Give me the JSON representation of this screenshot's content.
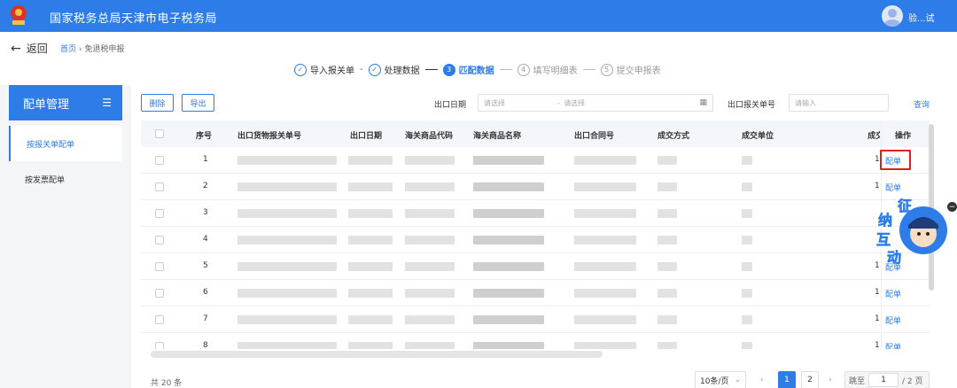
{
  "header": {
    "title": "国家税务总局天津市电子税务局",
    "user": "验...试"
  },
  "nav": {
    "back": "返回",
    "breadcrumb": [
      "首页",
      "免退税申报"
    ]
  },
  "steps": [
    {
      "label": "导入报关单",
      "status": "done",
      "mark": "✓"
    },
    {
      "label": "处理数据",
      "status": "done",
      "mark": "✓"
    },
    {
      "label": "匹配数据",
      "status": "active",
      "mark": "3"
    },
    {
      "label": "填写明细表",
      "status": "todo",
      "mark": "4"
    },
    {
      "label": "提交申报表",
      "status": "todo",
      "mark": "5"
    }
  ],
  "sidebar": {
    "title": "配单管理",
    "items": [
      {
        "label": "按报关单配单",
        "active": true
      },
      {
        "label": "按发票配单",
        "active": false
      }
    ]
  },
  "toolbar": {
    "delete_label": "删除",
    "export_label": "导出",
    "date_label": "出口日期",
    "date_start_placeholder": "请选择",
    "date_sep": "-",
    "date_end_placeholder": "请选择",
    "declaration_label": "出口报关单号",
    "declaration_placeholder": "请输入",
    "search_label": "查询"
  },
  "table": {
    "columns": [
      "序号",
      "出口货物报关单号",
      "出口日期",
      "海关商品代码",
      "海关商品名称",
      "出口合同号",
      "成交方式",
      "成交单位",
      "成交数",
      "操作"
    ],
    "rows": [
      {
        "no": "1",
        "qty": "1",
        "action": "配单"
      },
      {
        "no": "2",
        "qty": "1",
        "action": "配单"
      },
      {
        "no": "3",
        "qty": "",
        "action": ""
      },
      {
        "no": "4",
        "qty": "",
        "action": ""
      },
      {
        "no": "5",
        "qty": "1",
        "action": "配单"
      },
      {
        "no": "6",
        "qty": "1",
        "action": "配单"
      },
      {
        "no": "7",
        "qty": "1",
        "action": "配单"
      },
      {
        "no": "8",
        "qty": "1",
        "action": "配单"
      }
    ]
  },
  "footer": {
    "total": "共 20 条",
    "page_size": "10条/页",
    "pages": [
      "1",
      "2"
    ],
    "current_page": "1",
    "jump_label": "跳至",
    "jump_value": "1",
    "page_total": "/ 2 页"
  },
  "mascot": {
    "chars": [
      "征",
      "纳",
      "互",
      "动"
    ]
  },
  "colors": {
    "primary": "#2e7ce8",
    "highlight": "#e02020"
  }
}
